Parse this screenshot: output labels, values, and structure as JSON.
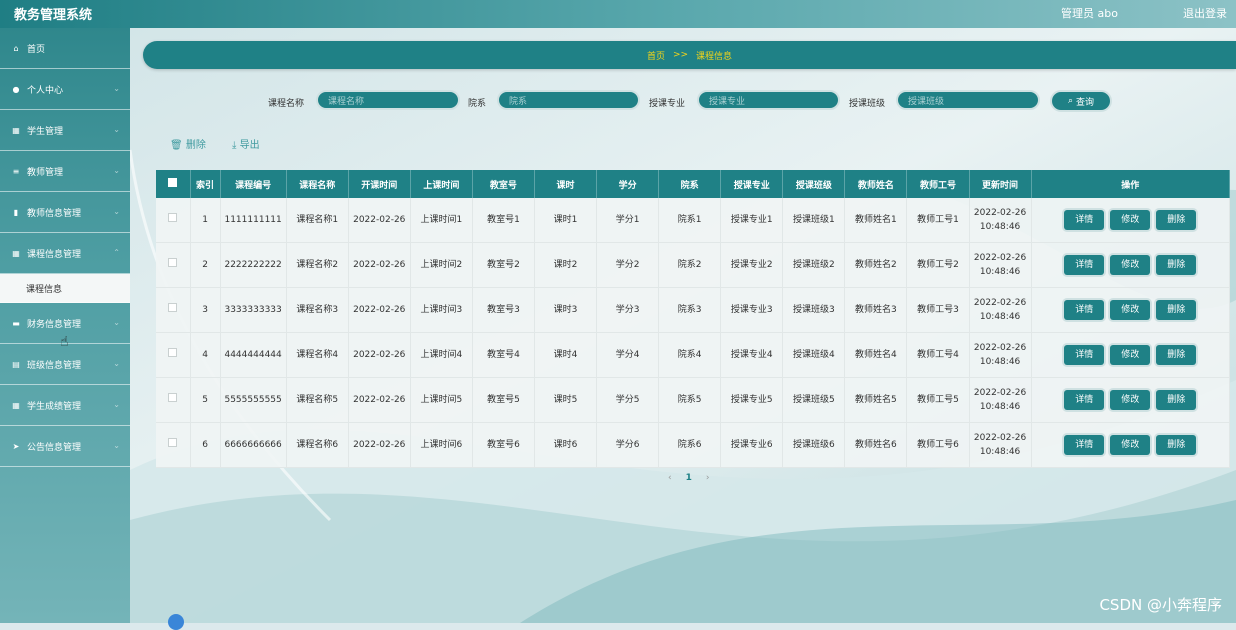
{
  "app": {
    "title": "教务管理系统",
    "user": "管理员 abo",
    "logout": "退出登录"
  },
  "sidebar": {
    "items": [
      {
        "label": "首页",
        "icon": "home-icon",
        "glyph": "⌂"
      },
      {
        "label": "个人中心",
        "icon": "user-icon",
        "glyph": "●"
      },
      {
        "label": "学生管理",
        "icon": "grid-icon",
        "glyph": "▦"
      },
      {
        "label": "教师管理",
        "icon": "list-icon",
        "glyph": "≡"
      },
      {
        "label": "教师信息管理",
        "icon": "bar-chart-icon",
        "glyph": "▮"
      },
      {
        "label": "课程信息管理",
        "icon": "grid-icon",
        "glyph": "▦"
      },
      {
        "label": "财务信息管理",
        "icon": "book-icon",
        "glyph": "▬"
      },
      {
        "label": "班级信息管理",
        "icon": "clipboard-icon",
        "glyph": "▤"
      },
      {
        "label": "学生成绩管理",
        "icon": "grid-icon",
        "glyph": "▦"
      },
      {
        "label": "公告信息管理",
        "icon": "send-icon",
        "glyph": "➤"
      }
    ],
    "sub_item": "课程信息"
  },
  "breadcrumb": {
    "home": "首页",
    "sep": ">>",
    "current": "课程信息"
  },
  "search": {
    "fields": [
      {
        "label": "课程名称",
        "placeholder": "课程名称"
      },
      {
        "label": "院系",
        "placeholder": "院系"
      },
      {
        "label": "授课专业",
        "placeholder": "授课专业"
      },
      {
        "label": "授课班级",
        "placeholder": "授课班级"
      }
    ],
    "button": "查询"
  },
  "toolbar": {
    "delete": "删除",
    "export": "导出"
  },
  "table": {
    "headers": [
      "索引",
      "课程编号",
      "课程名称",
      "开课时间",
      "上课时间",
      "教室号",
      "课时",
      "学分",
      "院系",
      "授课专业",
      "授课班级",
      "教师姓名",
      "教师工号",
      "更新时间",
      "操作"
    ],
    "rows": [
      {
        "idx": "1",
        "code": "1111111111",
        "name": "课程名称1",
        "start": "2022-02-26",
        "time": "上课时间1",
        "room": "教室号1",
        "hours": "课时1",
        "credit": "学分1",
        "dept": "院系1",
        "major": "授课专业1",
        "cls": "授课班级1",
        "teacher": "教师姓名1",
        "tno": "教师工号1",
        "updated": "2022-02-26 10:48:46"
      },
      {
        "idx": "2",
        "code": "2222222222",
        "name": "课程名称2",
        "start": "2022-02-26",
        "time": "上课时间2",
        "room": "教室号2",
        "hours": "课时2",
        "credit": "学分2",
        "dept": "院系2",
        "major": "授课专业2",
        "cls": "授课班级2",
        "teacher": "教师姓名2",
        "tno": "教师工号2",
        "updated": "2022-02-26 10:48:46"
      },
      {
        "idx": "3",
        "code": "3333333333",
        "name": "课程名称3",
        "start": "2022-02-26",
        "time": "上课时间3",
        "room": "教室号3",
        "hours": "课时3",
        "credit": "学分3",
        "dept": "院系3",
        "major": "授课专业3",
        "cls": "授课班级3",
        "teacher": "教师姓名3",
        "tno": "教师工号3",
        "updated": "2022-02-26 10:48:46"
      },
      {
        "idx": "4",
        "code": "4444444444",
        "name": "课程名称4",
        "start": "2022-02-26",
        "time": "上课时间4",
        "room": "教室号4",
        "hours": "课时4",
        "credit": "学分4",
        "dept": "院系4",
        "major": "授课专业4",
        "cls": "授课班级4",
        "teacher": "教师姓名4",
        "tno": "教师工号4",
        "updated": "2022-02-26 10:48:46"
      },
      {
        "idx": "5",
        "code": "5555555555",
        "name": "课程名称5",
        "start": "2022-02-26",
        "time": "上课时间5",
        "room": "教室号5",
        "hours": "课时5",
        "credit": "学分5",
        "dept": "院系5",
        "major": "授课专业5",
        "cls": "授课班级5",
        "teacher": "教师姓名5",
        "tno": "教师工号5",
        "updated": "2022-02-26 10:48:46"
      },
      {
        "idx": "6",
        "code": "6666666666",
        "name": "课程名称6",
        "start": "2022-02-26",
        "time": "上课时间6",
        "room": "教室号6",
        "hours": "课时6",
        "credit": "学分6",
        "dept": "院系6",
        "major": "授课专业6",
        "cls": "授课班级6",
        "teacher": "教师姓名6",
        "tno": "教师工号6",
        "updated": "2022-02-26 10:48:46"
      }
    ],
    "actions": {
      "detail": "详情",
      "edit": "修改",
      "delete": "删除"
    }
  },
  "pagination": {
    "prev": "‹",
    "current": "1",
    "next": "›"
  },
  "watermark": "CSDN @小奔程序",
  "colors": {
    "primary": "#1f8186",
    "accent": "#f3d51a"
  }
}
